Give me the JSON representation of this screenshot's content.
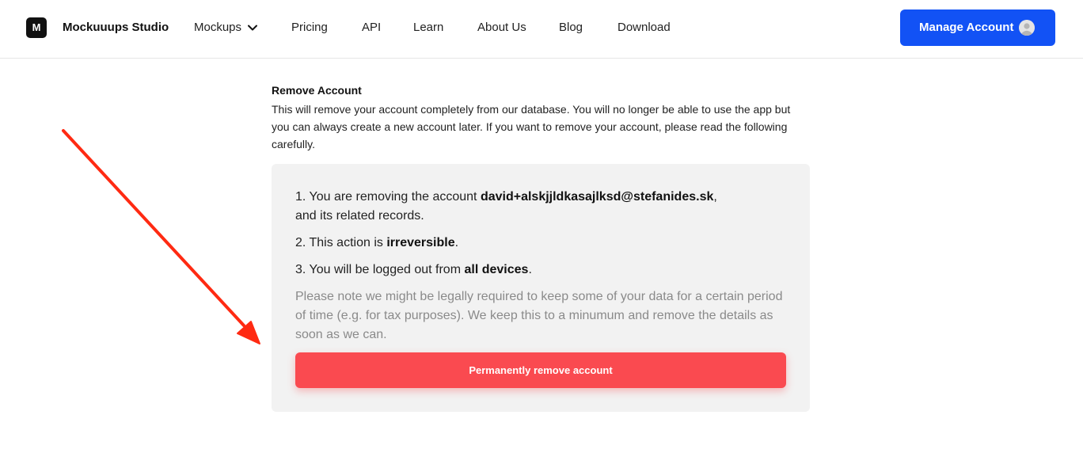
{
  "header": {
    "logo_letter": "M",
    "brand": "Mockuuups Studio",
    "nav": [
      "Mockups",
      "Pricing",
      "API",
      "Learn",
      "About Us",
      "Blog",
      "Download"
    ],
    "manage_button": "Manage Account"
  },
  "section": {
    "title": "Remove Account",
    "description": "This will remove your account completely from our database. You will no longer be able to use the app but you can always create a new account later. If you want to remove your account, please read the following carefully."
  },
  "panel": {
    "item1_prefix": "1. You are removing the account ",
    "item1_email": "david+alskjjldkasajlksd@stefanides.sk",
    "item1_suffix": ",",
    "item1_line2": "and its related records.",
    "item2_prefix": "2. This action is ",
    "item2_bold": "irreversible",
    "item2_suffix": ".",
    "item3_prefix": "3. You will be logged out from ",
    "item3_bold": "all devices",
    "item3_suffix": ".",
    "note": "Please note we might be legally required to keep some of your data for a certain period of time (e.g. for tax purposes). We keep this to a minumum and remove the details as soon as we can.",
    "remove_button": "Permanently remove account"
  },
  "colors": {
    "primary": "#1252f5",
    "danger": "#fa4a50",
    "annotation_arrow": "#ff2a12"
  },
  "icons": {
    "mockups_dropdown": "chevron-down-icon",
    "avatar": "user-avatar-icon",
    "annotation": "arrow-icon"
  }
}
